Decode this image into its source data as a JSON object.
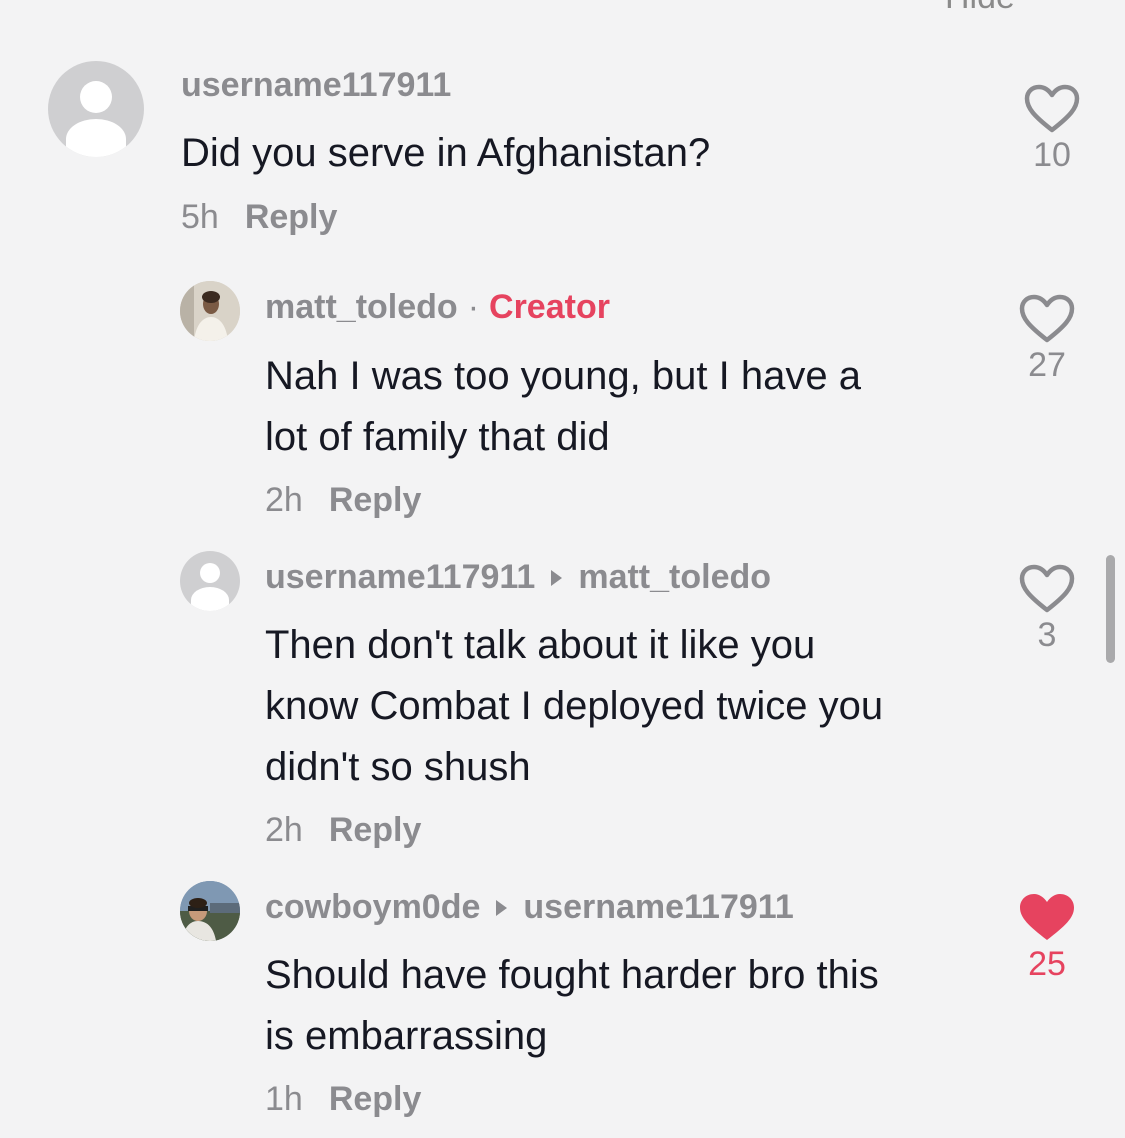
{
  "header": {
    "cut_label": "Hide"
  },
  "comments": [
    {
      "username": "username117911",
      "text": "Did you serve in Afghanistan?",
      "time": "5h",
      "reply_label": "Reply",
      "likes": "10",
      "liked": false
    },
    {
      "username": "matt_toledo",
      "separator": "·",
      "badge": "Creator",
      "text_lines": [
        "Nah I was too young, but I have a",
        "lot of family that did"
      ],
      "time": "2h",
      "reply_label": "Reply",
      "likes": "27",
      "liked": false
    },
    {
      "username": "username117911",
      "reply_to": "matt_toledo",
      "text_lines": [
        "Then don't talk about it like you",
        "know Combat I deployed twice you",
        "didn't so shush"
      ],
      "time": "2h",
      "reply_label": "Reply",
      "likes": "3",
      "liked": false
    },
    {
      "username": "cowboym0de",
      "reply_to": "username117911",
      "text_lines": [
        "Should have fought harder bro this",
        "is embarrassing"
      ],
      "time": "1h",
      "reply_label": "Reply",
      "likes": "25",
      "liked": true
    }
  ],
  "colors": {
    "background": "#f3f3f4",
    "accent": "#e6435f",
    "muted_text": "#8b8b8f",
    "primary_text": "#161823"
  },
  "icons": {
    "like": "heart-outline-icon",
    "liked": "heart-filled-icon",
    "reply_arrow": "triangle-right-icon",
    "default_avatar": "default-avatar-icon"
  }
}
